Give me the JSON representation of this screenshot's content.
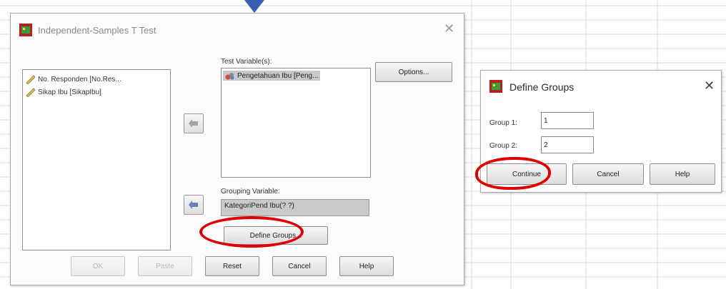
{
  "main_dialog": {
    "title": "Independent-Samples T Test",
    "source_variables": [
      {
        "label": "No. Responden [No.Res..."
      },
      {
        "label": "Sikap Ibu [SikapIbu]"
      }
    ],
    "test_variables_label": "Test Variable(s):",
    "test_variables": [
      {
        "label": "Pengetahuan Ibu [Peng..."
      }
    ],
    "grouping_variable_label": "Grouping Variable:",
    "grouping_variable_value": "KategoriPend Ibu(? ?)",
    "buttons": {
      "options": "Options...",
      "define_groups": "Define Groups...",
      "ok": "OK",
      "paste": "Paste",
      "reset": "Reset",
      "cancel": "Cancel",
      "help": "Help"
    }
  },
  "define_groups_dialog": {
    "title": "Define Groups",
    "group1_label": "Group 1:",
    "group1_value": "1",
    "group2_label": "Group 2:",
    "group2_value": "2",
    "buttons": {
      "continue": "Continue",
      "cancel": "Cancel",
      "help": "Help"
    }
  },
  "colors": {
    "highlight": "#e00000",
    "grid_line": "#dadada",
    "accent_arrow": "#3a5fb5"
  },
  "icons": [
    "app-icon",
    "ruler-variable-icon",
    "nominal-variable-icon",
    "move-right-arrow-icon",
    "close-icon"
  ]
}
